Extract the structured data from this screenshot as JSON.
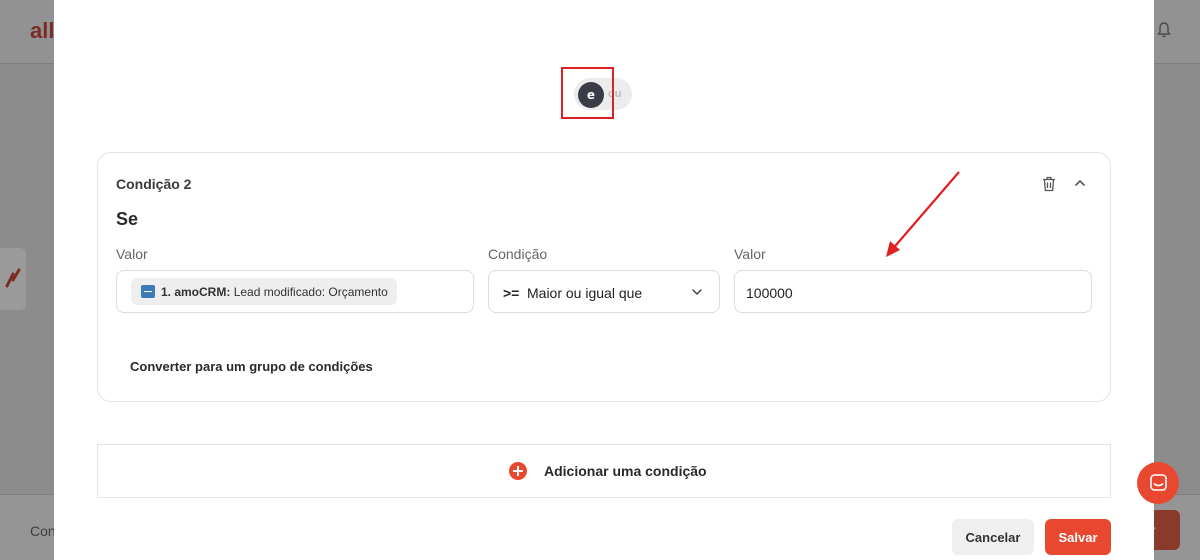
{
  "background": {
    "logo": "all",
    "footer_text": "Con",
    "footer_button": "r"
  },
  "toggle": {
    "and_label": "e",
    "or_label": "ou"
  },
  "condition": {
    "title": "Condição 2",
    "if_label": "Se",
    "columns": {
      "value_left_label": "Valor",
      "condition_label": "Condição",
      "value_right_label": "Valor"
    },
    "left_value": {
      "source": "1. amoCRM:",
      "field": "Lead modificado: Orçamento"
    },
    "operator": {
      "symbol": ">=",
      "text": "Maior ou igual que"
    },
    "right_value": "100000",
    "convert_link": "Converter para um grupo de condições"
  },
  "add_condition": "Adicionar uma condição",
  "actions": {
    "cancel": "Cancelar",
    "save": "Salvar"
  },
  "colors": {
    "accent": "#e8482f",
    "toggle_active": "#3a3d45",
    "annotation": "#e02020",
    "chip_icon": "#3d7ab8"
  }
}
